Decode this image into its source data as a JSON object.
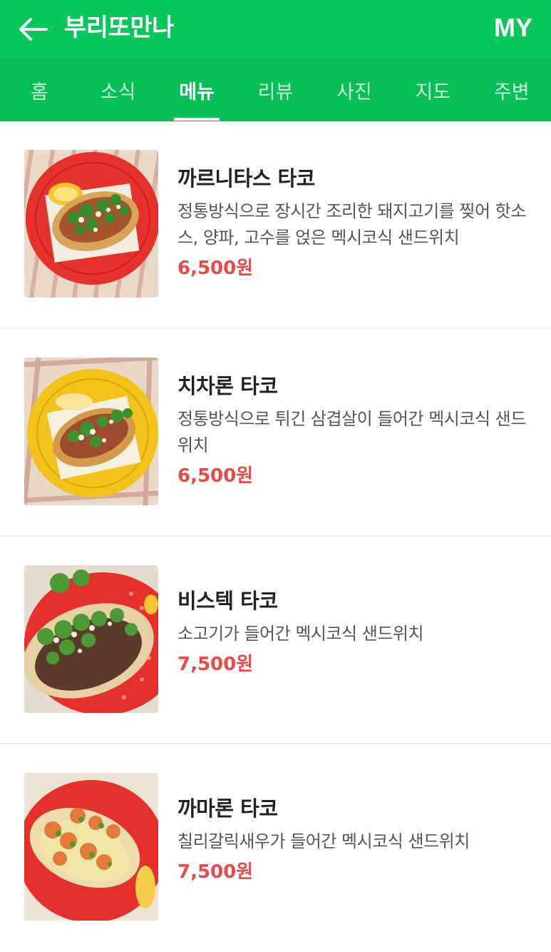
{
  "header": {
    "back_icon": "arrow-left-icon",
    "title": "부리또만나",
    "my_label": "MY",
    "bg_color": "#06c75a"
  },
  "tabs": [
    {
      "label": "홈",
      "active": false
    },
    {
      "label": "소식",
      "active": false
    },
    {
      "label": "메뉴",
      "active": true
    },
    {
      "label": "리뷰",
      "active": false
    },
    {
      "label": "사진",
      "active": false
    },
    {
      "label": "지도",
      "active": false
    },
    {
      "label": "주변",
      "active": false
    }
  ],
  "menu": {
    "items": [
      {
        "name": "까르니타스 타코",
        "description": "정통방식으로 장시간 조리한 돼지고기를 찢어 핫소스, 양파, 고수를 얹은 멕시코식 샌드위치",
        "price": "6,500원",
        "plate_color": "#e5302b"
      },
      {
        "name": "치차론 타코",
        "description": "정통방식으로 튀긴 삼겹살이 들어간 멕시코식 샌드위치",
        "price": "6,500원",
        "plate_color": "#f2c21a"
      },
      {
        "name": "비스텍 타코",
        "description": "소고기가 들어간 멕시코식 샌드위치",
        "price": "7,500원",
        "plate_color": "#e5302b"
      },
      {
        "name": "까마론 타코",
        "description": "칠리갈릭새우가 들어간 멕시코식 샌드위치",
        "price": "7,500원",
        "plate_color": "#e5302b"
      }
    ]
  },
  "colors": {
    "accent": "#06c75a",
    "price": "#e54b4b"
  }
}
